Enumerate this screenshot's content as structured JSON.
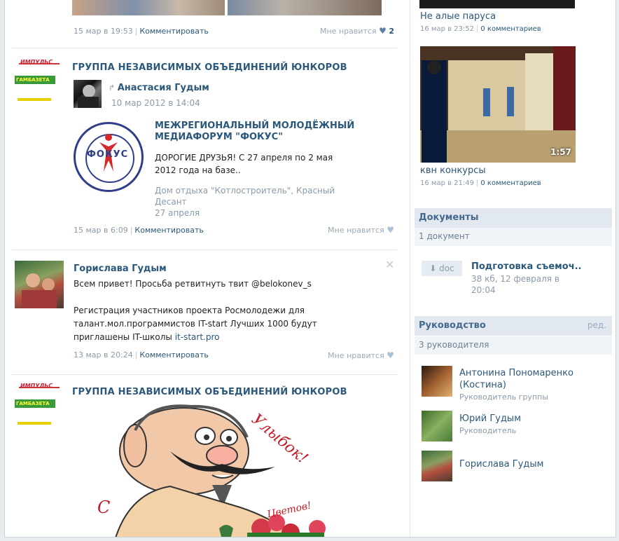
{
  "feed": {
    "post0": {
      "date": "15 мар в 19:53",
      "comment_label": "Комментировать",
      "like_label": "Мне нравится",
      "like_count": "2"
    },
    "post1": {
      "group_title": "ГРУППА НЕЗАВИСИМЫХ ОБЪЕДИНЕНИЙ ЮНКОРОВ",
      "repost_author": "Анастасия Гудым",
      "repost_date": "10 мар 2012 в 14:04",
      "event_title_line1": "МЕЖРЕГИОНАЛЬНЫЙ МОЛОДЁЖНЫЙ",
      "event_title_line2": "МЕДИАФОРУМ \"ФОКУС\"",
      "event_desc_line1": "ДОРОГИЕ ДРУЗЬЯ! С 27 апреля по 2 мая",
      "event_desc_line2": "2012 года на базе..",
      "event_place_line1": "Дом отдыха \"Котлостроитель\", Красный",
      "event_place_line2": "Десант",
      "event_date": "27 апреля",
      "logo_word": "ФОКУС",
      "date": "15 мар в 6:09",
      "comment_label": "Комментировать",
      "like_label": "Мне нравится"
    },
    "post2": {
      "author": "Горислава Гудым",
      "text_line1": "Всем привет! Просьба ретвитнуть твит @belokonev_s",
      "text_line3": "Регистрация участников проекта Росмолодежи для",
      "text_line4": "талант.мол.программистов IT-start Лучших 1000 будут",
      "text_line5_prefix": "приглашены IT-школы ",
      "text_link": "it-start.pro",
      "date": "13 мар в 20:24",
      "comment_label": "Комментировать",
      "like_label": "Мне нравится"
    },
    "post3": {
      "group_title": "ГРУППА НЕЗАВИСИМЫХ ОБЪЕДИНЕНИЙ ЮНКОРОВ",
      "cartoon_text1": "Улыбок!",
      "cartoon_text2": "С",
      "cartoon_text3": "Цветов!"
    },
    "group_logo_text": "ИМПУЛЬС",
    "group_logo_green": "ГАМБАЗЕТА"
  },
  "side": {
    "video1": {
      "title": "Не алые паруса",
      "date": "16 мар в 23:52",
      "comments": "0 комментариев"
    },
    "video2": {
      "title": "квн конкурсы",
      "date": "16 мар в 21:49",
      "comments": "0 комментариев",
      "duration": "1:57"
    },
    "documents": {
      "header": "Документы",
      "count": "1 документ",
      "badge": "doc",
      "name": "Подготовка съемоч..",
      "meta_line1": "38 кб, 12 февраля в",
      "meta_line2": "20:04"
    },
    "management": {
      "header": "Руководство",
      "edit": "ред.",
      "count": "3 руководителя",
      "people": [
        {
          "name_line1": "Антонина Пономаренко",
          "name_line2": "(Костина)",
          "role": "Руководитель группы"
        },
        {
          "name_line1": "Юрий Гудым",
          "name_line2": "",
          "role": "Руководитель"
        },
        {
          "name_line1": "Горислава Гудым",
          "name_line2": "",
          "role": ""
        }
      ]
    }
  }
}
